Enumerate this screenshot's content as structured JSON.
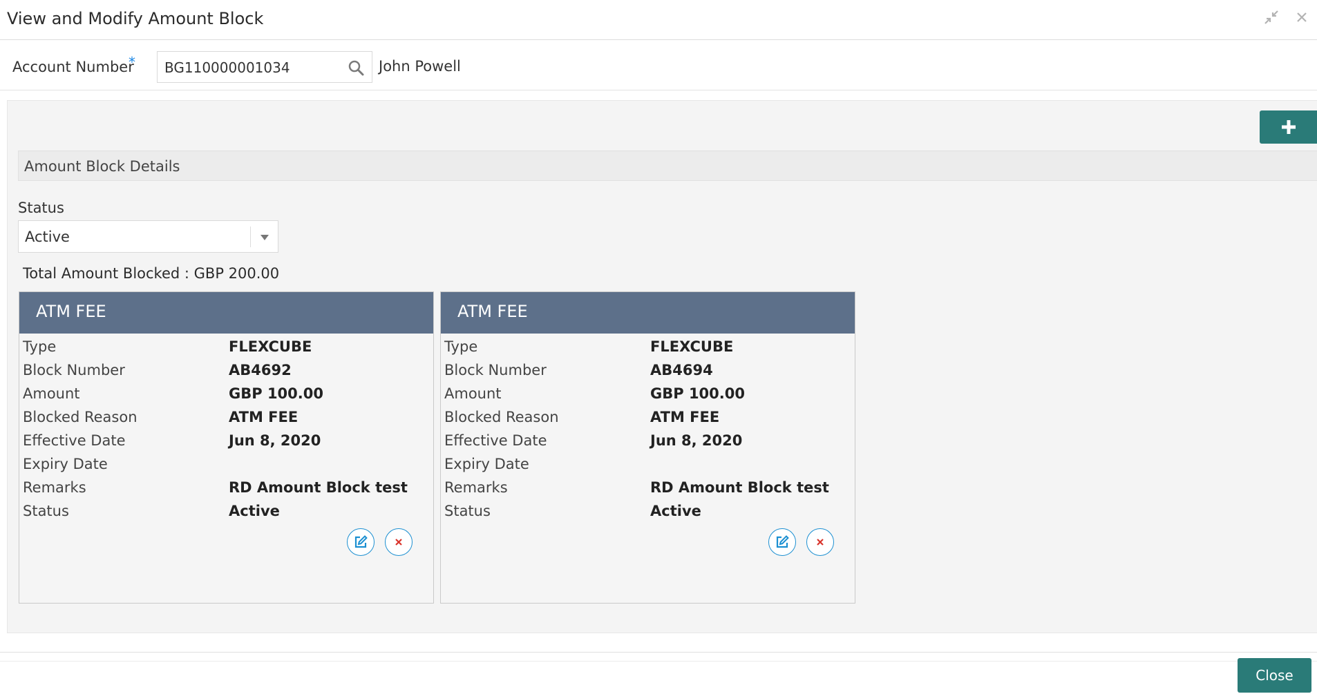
{
  "window": {
    "title": "View and Modify Amount Block",
    "minimize_icon": "collapse-arrows-icon",
    "close_icon": "close-icon"
  },
  "account": {
    "label": "Account Number",
    "required_marker": "*",
    "value": "BG110000001034",
    "search_icon": "search-icon",
    "holder_name": "John Powell"
  },
  "section": {
    "add_icon": "plus-icon",
    "title": "Amount Block Details"
  },
  "filter": {
    "status_label": "Status",
    "status_value": "Active",
    "caret_icon": "caret-down-icon"
  },
  "total_blocked": "Total Amount Blocked : GBP 200.00",
  "field_labels": {
    "type": "Type",
    "block_number": "Block Number",
    "amount": "Amount",
    "blocked_reason": "Blocked Reason",
    "effective_date": "Effective Date",
    "expiry_date": "Expiry Date",
    "remarks": "Remarks",
    "status": "Status"
  },
  "cards": [
    {
      "title": "ATM FEE",
      "type": "FLEXCUBE",
      "block_number": "AB4692",
      "amount": "GBP 100.00",
      "blocked_reason": "ATM FEE",
      "effective_date": "Jun 8, 2020",
      "expiry_date": "",
      "remarks": "RD Amount Block test",
      "status": "Active"
    },
    {
      "title": "ATM FEE",
      "type": "FLEXCUBE",
      "block_number": "AB4694",
      "amount": "GBP 100.00",
      "blocked_reason": "ATM FEE",
      "effective_date": "Jun 8, 2020",
      "expiry_date": "",
      "remarks": "RD Amount Block test",
      "status": "Active"
    }
  ],
  "footer": {
    "close_label": "Close"
  },
  "colors": {
    "primary_teal": "#2a7b78",
    "card_header": "#5d708a",
    "edit_blue": "#1b8fd1",
    "delete_red": "#d9342b",
    "required_blue": "#1e88e5"
  }
}
